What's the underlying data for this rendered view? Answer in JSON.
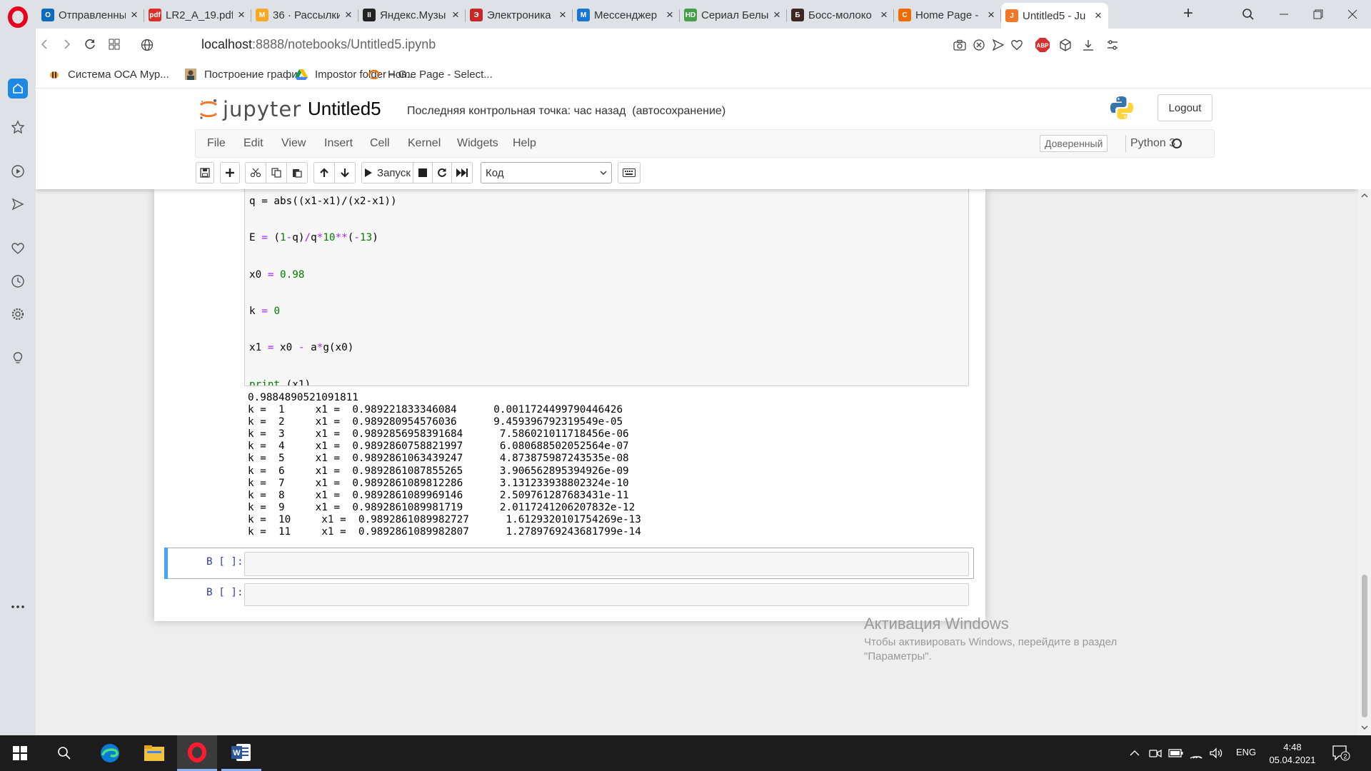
{
  "browser": {
    "tabs": [
      {
        "title": "Отправленны",
        "favicon": "outlook-icon",
        "color": "#0f6cbd",
        "letter": "O"
      },
      {
        "title": "LR2_A_19.pdf",
        "favicon": "pdf-icon",
        "color": "#d93025",
        "letter": "pdf"
      },
      {
        "title": "36 · Рассылки",
        "favicon": "mail-icon",
        "color": "#f9a825",
        "letter": "M"
      },
      {
        "title": "Яндекс.Музы",
        "favicon": "yandex-music-icon",
        "color": "#222222",
        "letter": "II"
      },
      {
        "title": "Электроника",
        "favicon": "shop-icon",
        "color": "#c62828",
        "letter": "Э"
      },
      {
        "title": "Мессенджер",
        "favicon": "messenger-icon",
        "color": "#1976d2",
        "letter": "M"
      },
      {
        "title": "Сериал Белы",
        "favicon": "hd-icon",
        "color": "#43a047",
        "letter": "HD"
      },
      {
        "title": "Босс-молоко",
        "favicon": "boss-baby-icon",
        "color": "#3e2723",
        "letter": "Б"
      },
      {
        "title": "Home Page -",
        "favicon": "home-page-icon",
        "color": "#ef6c00",
        "letter": "C"
      },
      {
        "title": "Untitled5 - Ju",
        "favicon": "jupyter-icon",
        "color": "#f37726",
        "letter": "J",
        "active": true
      }
    ],
    "url_host": "localhost",
    "url_path": ":8888/notebooks/Untitled5.ipynb",
    "bookmarks": [
      {
        "label": "Система ОСА Мур...",
        "icon": "bee-icon"
      },
      {
        "label": "Построение графи...",
        "icon": "person-icon"
      },
      {
        "label": "Impostor folder – G...",
        "icon": "google-drive-icon"
      },
      {
        "label": "Home Page - Select...",
        "icon": "home-page-icon"
      }
    ]
  },
  "jupyter": {
    "logo_text": "jupyter",
    "notebook_name": "Untitled5",
    "checkpoint": "Последняя контрольная точка: час назад",
    "autosave": "(автосохранение)",
    "logout_label": "Logout",
    "menu": [
      "File",
      "Edit",
      "View",
      "Insert",
      "Cell",
      "Kernel",
      "Widgets",
      "Help"
    ],
    "trusted_label": "Доверенный",
    "kernel_name": "Python 3",
    "run_label": "Запуск",
    "cell_type": "Код"
  },
  "cell": {
    "code_top_partial": "q = abs((x1-x1)/(x2-x1))",
    "output": [
      "0.9884890521091811",
      "k =  1     x1 =  0.989221833346084      0.0011724499790446426",
      "k =  2     x1 =  0.989280954576036      9.459396792319549e-05",
      "k =  3     x1 =  0.9892856958391684      7.586021011718456e-06",
      "k =  4     x1 =  0.9892860758821997      6.080688502052564e-07",
      "k =  5     x1 =  0.9892861063439247      4.873875987243535e-08",
      "k =  6     x1 =  0.9892861087855265      3.906562895394926e-09",
      "k =  7     x1 =  0.9892861089812286      3.131233938802324e-10",
      "k =  8     x1 =  0.9892861089969146      2.509761287683431e-11",
      "k =  9     x1 =  0.9892861089981719      2.0117241206207832e-12",
      "k =  10     x1 =  0.9892861089982727      1.6129320101754269e-13",
      "k =  11     x1 =  0.9892861089982807      1.2789769243681799e-14"
    ],
    "empty_prompt": "В [ ]:"
  },
  "watermark": {
    "title": "Активация Windows",
    "subtitle": "Чтобы активировать Windows, перейдите в раздел \"Параметры\"."
  },
  "taskbar": {
    "lang": "ENG",
    "time": "4:48",
    "date": "05.04.2021",
    "notifications": "2"
  }
}
